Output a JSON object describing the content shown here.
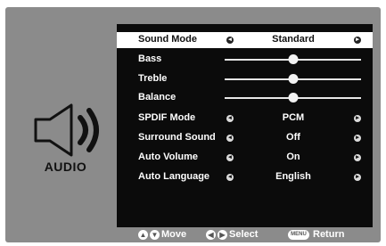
{
  "side": {
    "label": "AUDIO",
    "icon": "speaker-icon"
  },
  "menu": {
    "sound_mode": {
      "label": "Sound Mode",
      "value": "Standard"
    },
    "bass": {
      "label": "Bass",
      "level": 0.5
    },
    "treble": {
      "label": "Treble",
      "level": 0.5
    },
    "balance": {
      "label": "Balance",
      "level": 0.5
    },
    "spdif_mode": {
      "label": "SPDIF Mode",
      "value": "PCM"
    },
    "surround_sound": {
      "label": "Surround Sound",
      "value": "Off"
    },
    "auto_volume": {
      "label": "Auto Volume",
      "value": "On"
    },
    "auto_language": {
      "label": "Auto Language",
      "value": "English"
    }
  },
  "footer": {
    "move": "Move",
    "select": "Select",
    "menu_key": "MENU",
    "return": "Return"
  },
  "colors": {
    "panel_bg": "#0b0b0b",
    "frame_bg": "#8b8b8b",
    "selected_row_bg": "#ffffff"
  }
}
